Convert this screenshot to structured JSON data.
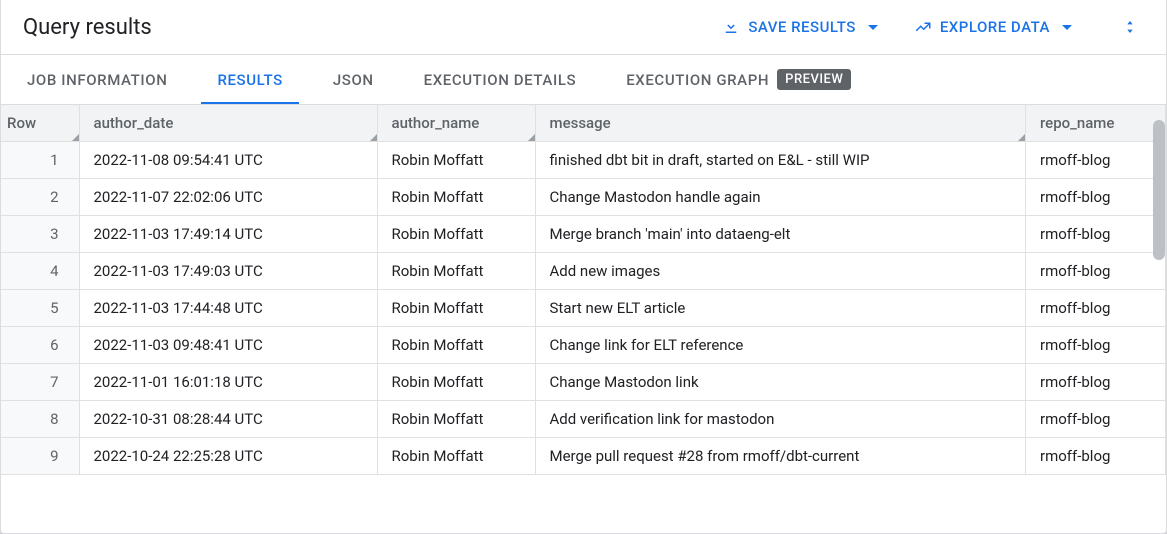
{
  "header": {
    "title": "Query results",
    "save_results": "SAVE RESULTS",
    "explore_data": "EXPLORE DATA"
  },
  "tabs": {
    "job_info": "JOB INFORMATION",
    "results": "RESULTS",
    "json": "JSON",
    "exec_details": "EXECUTION DETAILS",
    "exec_graph": "EXECUTION GRAPH",
    "preview_badge": "PREVIEW"
  },
  "columns": {
    "row": "Row",
    "author_date": "author_date",
    "author_name": "author_name",
    "message": "message",
    "repo_name": "repo_name"
  },
  "rows": [
    {
      "n": "1",
      "date": "2022-11-08 09:54:41 UTC",
      "name": "Robin Moffatt",
      "msg": "finished dbt bit in draft, started on E&L - still WIP",
      "repo": "rmoff-blog"
    },
    {
      "n": "2",
      "date": "2022-11-07 22:02:06 UTC",
      "name": "Robin Moffatt",
      "msg": "Change Mastodon handle again",
      "repo": "rmoff-blog"
    },
    {
      "n": "3",
      "date": "2022-11-03 17:49:14 UTC",
      "name": "Robin Moffatt",
      "msg": "Merge branch 'main' into dataeng-elt",
      "repo": "rmoff-blog"
    },
    {
      "n": "4",
      "date": "2022-11-03 17:49:03 UTC",
      "name": "Robin Moffatt",
      "msg": "Add new images",
      "repo": "rmoff-blog"
    },
    {
      "n": "5",
      "date": "2022-11-03 17:44:48 UTC",
      "name": "Robin Moffatt",
      "msg": "Start new ELT article",
      "repo": "rmoff-blog"
    },
    {
      "n": "6",
      "date": "2022-11-03 09:48:41 UTC",
      "name": "Robin Moffatt",
      "msg": "Change link for ELT reference",
      "repo": "rmoff-blog"
    },
    {
      "n": "7",
      "date": "2022-11-01 16:01:18 UTC",
      "name": "Robin Moffatt",
      "msg": "Change Mastodon link",
      "repo": "rmoff-blog"
    },
    {
      "n": "8",
      "date": "2022-10-31 08:28:44 UTC",
      "name": "Robin Moffatt",
      "msg": "Add verification link for mastodon",
      "repo": "rmoff-blog"
    },
    {
      "n": "9",
      "date": "2022-10-24 22:25:28 UTC",
      "name": "Robin Moffatt",
      "msg": "Merge pull request #28 from rmoff/dbt-current",
      "repo": "rmoff-blog"
    }
  ]
}
